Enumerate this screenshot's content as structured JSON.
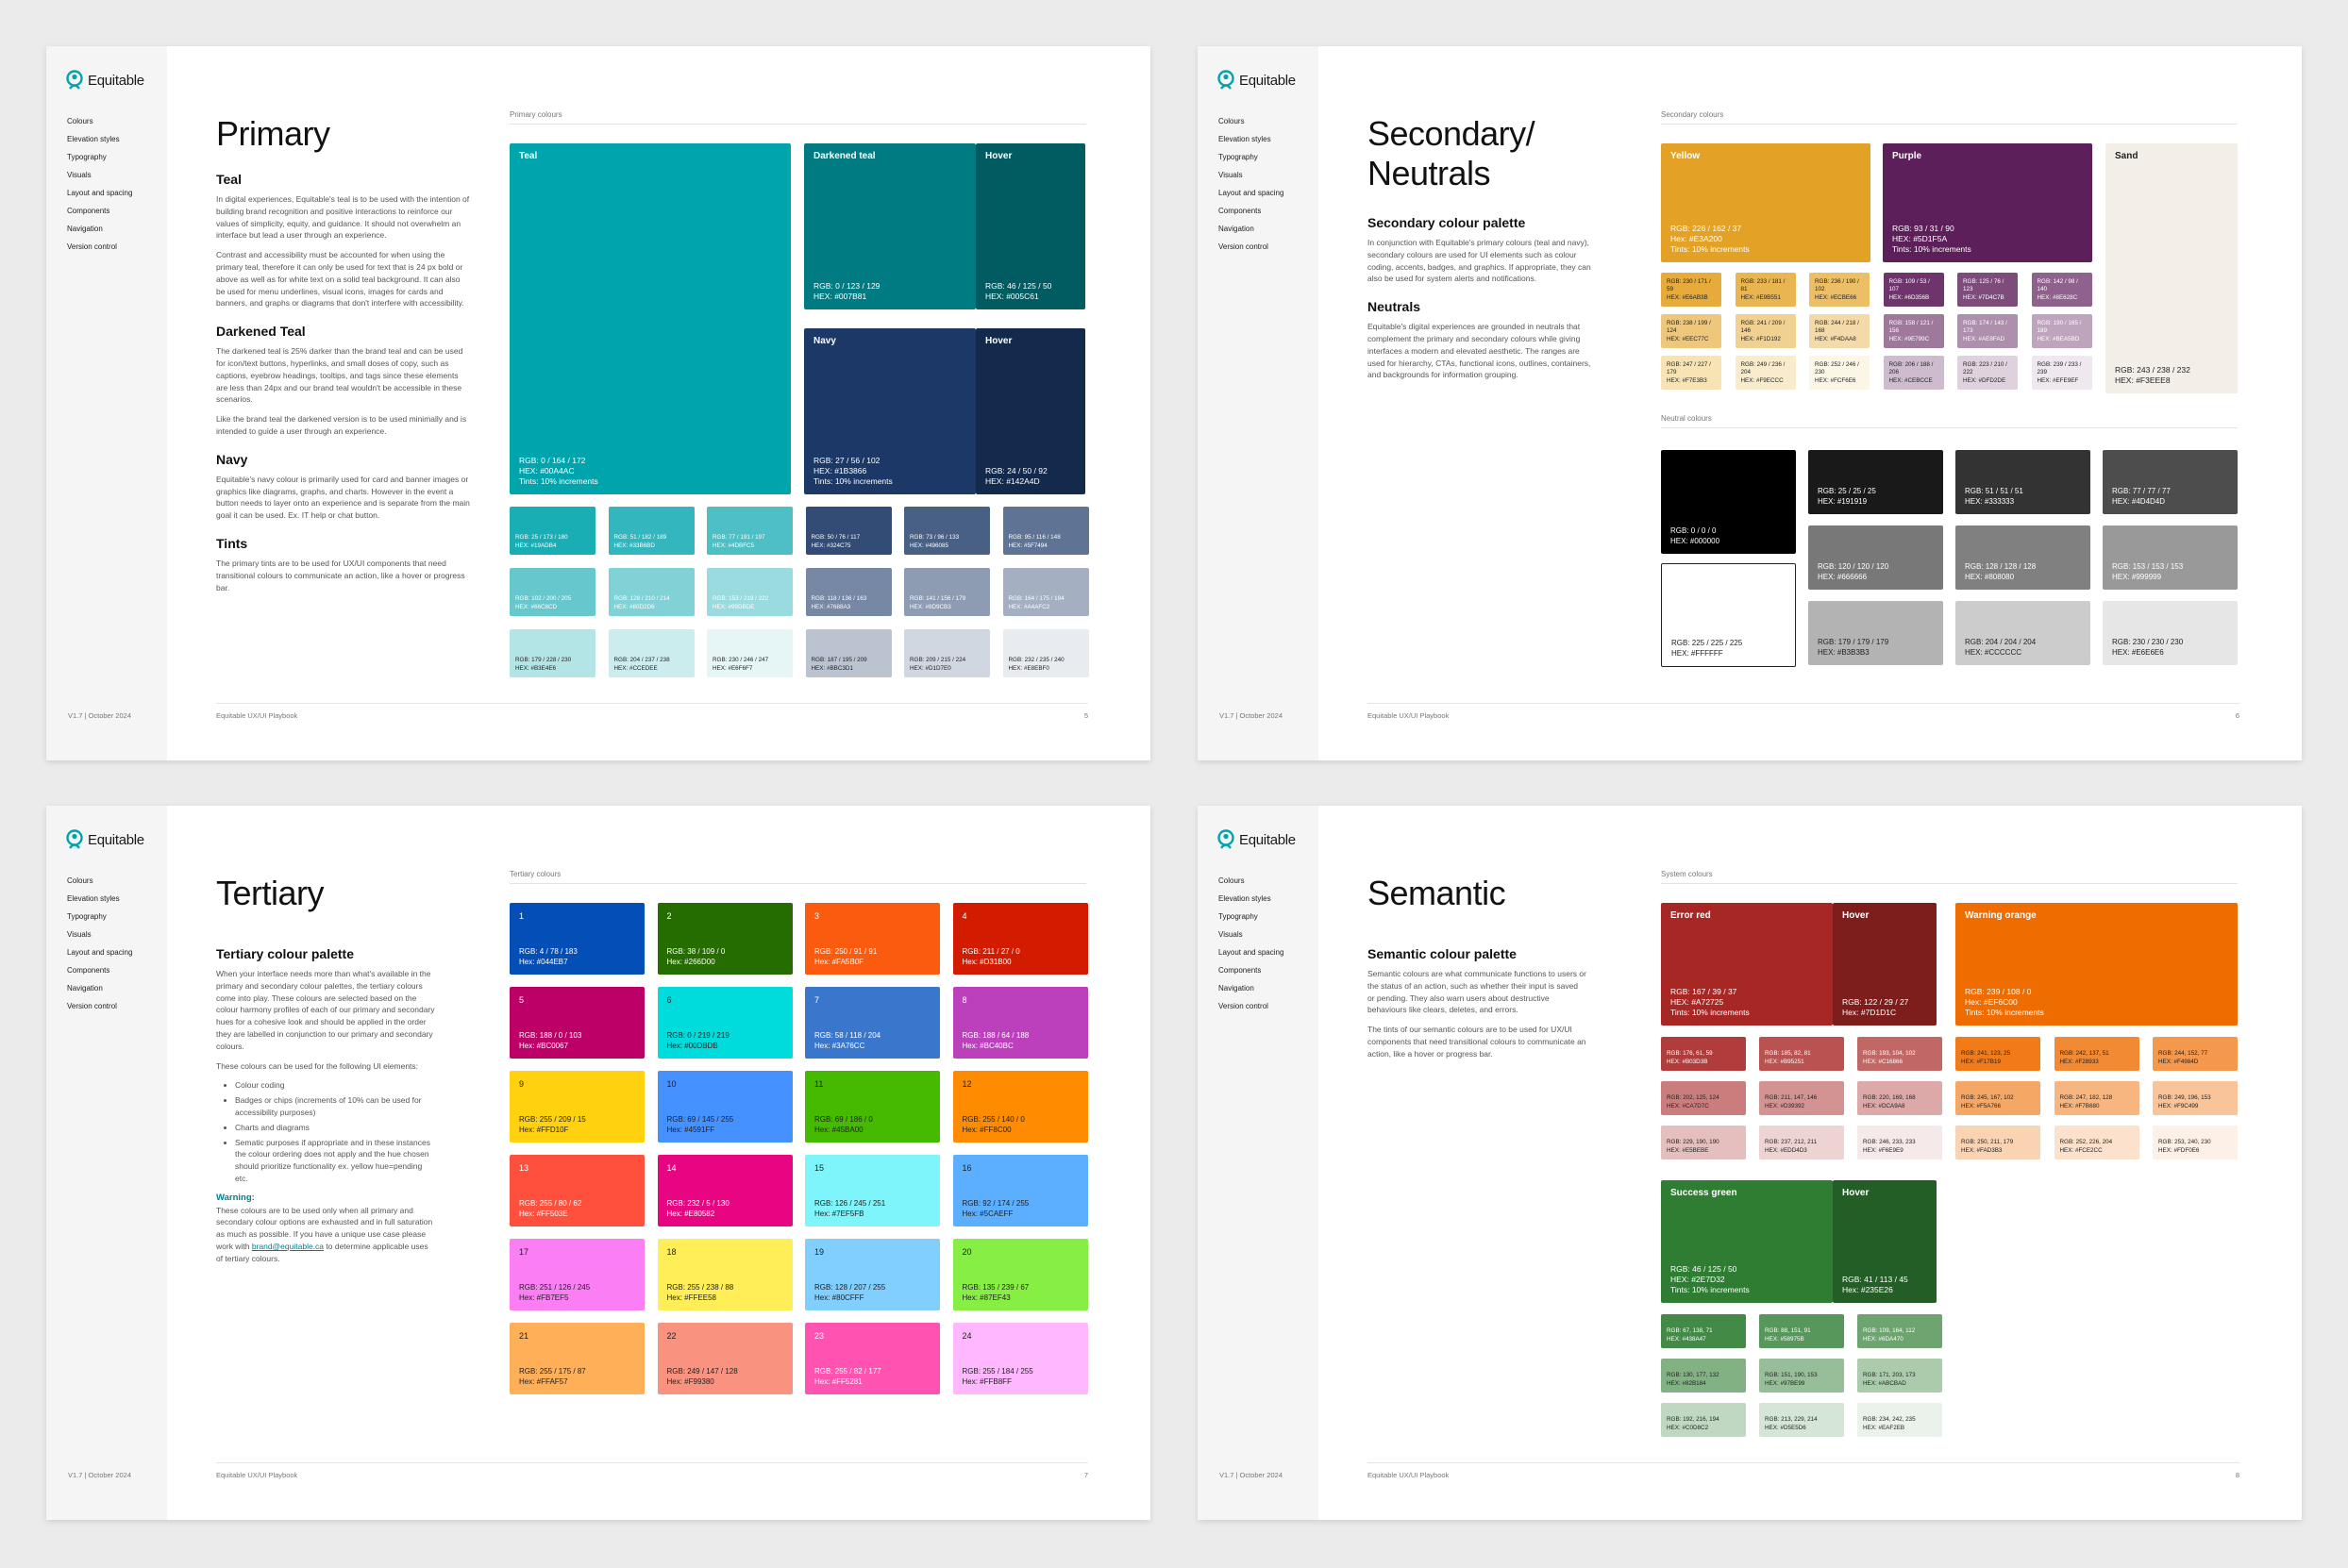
{
  "brand": "Equitable",
  "nav": [
    "Colours",
    "Elevation styles",
    "Typography",
    "Visuals",
    "Layout and spacing",
    "Components",
    "Navigation",
    "Version control"
  ],
  "version": "V1.7 | October 2024",
  "footer": "Equitable UX/UI Playbook",
  "p1": {
    "page": "5",
    "title": "Primary",
    "section": "Primary colours",
    "teal_h": "Teal",
    "teal_p1": "In digital experiences, Equitable's teal is to be used with the intention of building brand recognition and positive interactions to reinforce our values of simplicity, equity, and guidance. It should not overwhelm an interface but lead a user through an experience.",
    "teal_p2": "Contrast and accessibility must be accounted for when using the primary teal, therefore it can only be used for text that is 24 px bold or above as well as for white text on a solid teal background. It can also be used for menu underlines, visual icons, images for cards and banners, and graphs or diagrams that don't interfere with accessibility.",
    "dark_h": "Darkened Teal",
    "dark_p1": "The darkened teal is 25% darker than the brand teal and can be used for icon/text buttons, hyperlinks, and small doses of copy, such as captions, eyebrow headings, tooltips, and tags since these elements are less than 24px and our brand teal wouldn't be accessible in these scenarios.",
    "dark_p2": "Like the brand teal the darkened version is to be used minimally and is intended to guide a user through an experience.",
    "navy_h": "Navy",
    "navy_p": "Equitable's navy colour is primarily used for card and banner images or graphics like diagrams, graphs, and charts. However in the event a button needs to layer onto an experience and is separate from the main goal it can be used. Ex. IT help or chat button.",
    "tints_h": "Tints",
    "tints_p": "The primary tints are to be used for UX/UI components that need transitional colours to communicate an action, like a hover or progress bar.",
    "teal": {
      "name": "Teal",
      "rgb": "RGB: 0 / 164 / 172",
      "hex": "HEX: #00A4AC",
      "tints": "Tints: 10% increments",
      "color": "#00a4ac"
    },
    "dteal": {
      "name": "Darkened teal",
      "rgb": "RGB: 0 / 123 / 129",
      "hex": "HEX: #007B81",
      "color": "#007b81"
    },
    "dteal_hover": {
      "name": "Hover",
      "rgb": "RGB: 46 / 125 / 50",
      "hex": "HEX: #005C61",
      "color": "#005c61"
    },
    "navy": {
      "name": "Navy",
      "rgb": "RGB: 27 / 56 / 102",
      "hex": "HEX: #1B3866",
      "tints": "Tints: 10% increments",
      "color": "#1b3866"
    },
    "navy_hover": {
      "name": "Hover",
      "rgb": "RGB: 24 / 50 / 92",
      "hex": "HEX: #142A4D",
      "color": "#142a4d"
    },
    "tints": [
      {
        "rgb": "RGB: 25 / 173 / 180",
        "hex": "HEX: #19ADB4",
        "color": "#19adb4"
      },
      {
        "rgb": "RGB: 51 / 182 / 189",
        "hex": "HEX: #33B6BD",
        "color": "#33b6bd"
      },
      {
        "rgb": "RGB: 77 / 191 / 197",
        "hex": "HEX: #4DBFC5",
        "color": "#4dbfc5"
      },
      {
        "rgb": "RGB: 50 / 76 / 117",
        "hex": "HEX: #324C75",
        "color": "#324c75"
      },
      {
        "rgb": "RGB: 73 / 96 / 133",
        "hex": "HEX: #496085",
        "color": "#496085"
      },
      {
        "rgb": "RGB: 95 / 116 / 148",
        "hex": "HEX: #5F7494",
        "color": "#5f7494"
      },
      {
        "rgb": "RGB: 102 / 200 / 205",
        "hex": "HEX: #66C8CD",
        "color": "#66c8cd"
      },
      {
        "rgb": "RGB: 128 / 210 / 214",
        "hex": "HEX: #80D2D6",
        "color": "#80d2d6"
      },
      {
        "rgb": "RGB: 153 / 219 / 222",
        "hex": "HEX: #99DBDE",
        "color": "#99dbde"
      },
      {
        "rgb": "RGB: 118 / 136 / 163",
        "hex": "HEX: #7688A3",
        "color": "#7688a3"
      },
      {
        "rgb": "RGB: 141 / 156 / 179",
        "hex": "HEX: #8D9CB3",
        "color": "#8d9cb3"
      },
      {
        "rgb": "RGB: 164 / 175 / 194",
        "hex": "HEX: #A4AFC2",
        "color": "#a4afc2"
      },
      {
        "rgb": "RGB: 179 / 228 / 230",
        "hex": "HEX: #B3E4E6",
        "color": "#b3e4e6"
      },
      {
        "rgb": "RGB: 204 / 237 / 238",
        "hex": "HEX: #CCEDEE",
        "color": "#ccedee"
      },
      {
        "rgb": "RGB: 230 / 246 / 247",
        "hex": "HEX: #E6F6F7",
        "color": "#e6f6f7"
      },
      {
        "rgb": "RGB: 187 / 195 / 209",
        "hex": "HEX: #BBC3D1",
        "color": "#bbc3d1"
      },
      {
        "rgb": "RGB: 209 / 215 / 224",
        "hex": "HEX: #D1D7E0",
        "color": "#d1d7e0"
      },
      {
        "rgb": "RGB: 232 / 235 / 240",
        "hex": "HEX: #E8EBF0",
        "color": "#e8ebf0"
      }
    ]
  },
  "p2": {
    "page": "6",
    "title": "Secondary/ Neutrals",
    "section": "Secondary colours",
    "section2": "Neutral colours",
    "sec_h": "Secondary colour palette",
    "sec_p": "In conjunction with Equitable's primary colours (teal and navy), secondary colours are used for UI elements such as colour coding, accents, badges, and graphics. If appropriate, they can also be used for system alerts and notifications.",
    "neu_h": "Neutrals",
    "neu_p": "Equitable's digital experiences are grounded in neutrals that complement the primary and secondary colours while giving interfaces a modern and elevated aesthetic. The ranges are used for hierarchy, CTAs, functional icons, outlines, containers, and backgrounds for information grouping.",
    "yellow": {
      "name": "Yellow",
      "rgb": "RGB: 226 / 162 / 37",
      "hex": "Hex: #E3A200",
      "tints": "Tints: 10% increments",
      "color": "#e3a225"
    },
    "purple": {
      "name": "Purple",
      "rgb": "RGB: 93 / 31 / 90",
      "hex": "HEX: #5D1F5A",
      "tints": "Tints: 10% increments",
      "color": "#5d1f5a"
    },
    "sand": {
      "name": "Sand",
      "rgb": "RGB: 243 / 238 / 232",
      "hex": "HEX: #F3EEE8",
      "color": "#f3eee8"
    },
    "tints": [
      {
        "rgb": "RGB: 230 / 171 / 59",
        "hex": "HEX: #E6AB3B",
        "color": "#e6ab3b"
      },
      {
        "rgb": "RGB: 233 / 181 / 81",
        "hex": "HEX: #E9B551",
        "color": "#e9b551"
      },
      {
        "rgb": "RGB: 236 / 190 / 102",
        "hex": "HEX: #ECBE66",
        "color": "#ecbe66"
      },
      {
        "rgb": "RGB: 109 / 53 / 107",
        "hex": "HEX: #6D356B",
        "color": "#6d356b"
      },
      {
        "rgb": "RGB: 125 / 76 / 123",
        "hex": "HEX: #7D4C7B",
        "color": "#7d4c7b"
      },
      {
        "rgb": "RGB: 142 / 98 / 140",
        "hex": "HEX: #8E628C",
        "color": "#8e628c"
      },
      {
        "rgb": "RGB: 238 / 199 / 124",
        "hex": "HEX: #EEC77C",
        "color": "#eec77c"
      },
      {
        "rgb": "RGB: 241 / 209 / 146",
        "hex": "HEX: #F1D192",
        "color": "#f1d192"
      },
      {
        "rgb": "RGB: 244 / 218 / 168",
        "hex": "HEX: #F4DAA8",
        "color": "#f4daa8"
      },
      {
        "rgb": "RGB: 158 / 121 / 156",
        "hex": "HEX: #9E799C",
        "color": "#9e799c"
      },
      {
        "rgb": "RGB: 174 / 143 / 173",
        "hex": "HEX: #AE8FAD",
        "color": "#ae8fad"
      },
      {
        "rgb": "RGB: 190 / 165 / 189",
        "hex": "HEX: #BEA5BD",
        "color": "#bea5bd"
      },
      {
        "rgb": "RGB: 247 / 227 / 179",
        "hex": "HEX: #F7E3B3",
        "color": "#f7e3b3"
      },
      {
        "rgb": "RGB: 249 / 236 / 204",
        "hex": "HEX: #F9ECCC",
        "color": "#f9eccc"
      },
      {
        "rgb": "RGB: 252 / 246 / 230",
        "hex": "HEX: #FCF6E6",
        "color": "#fcf6e6"
      },
      {
        "rgb": "RGB: 206 / 188 / 206",
        "hex": "HEX: #CEBCCE",
        "color": "#cebcce"
      },
      {
        "rgb": "RGB: 223 / 210 / 222",
        "hex": "HEX: #DFD2DE",
        "color": "#dfd2de"
      },
      {
        "rgb": "RGB: 239 / 233 / 239",
        "hex": "HEX: #EFE9EF",
        "color": "#efe9ef"
      }
    ],
    "neutrals": [
      {
        "rgb": "RGB: 0 / 0 / 0",
        "hex": "HEX: #000000",
        "color": "#000000",
        "dark": true
      },
      {
        "rgb": "RGB: 25 / 25 / 25",
        "hex": "HEX: #191919",
        "color": "#191919",
        "dark": true
      },
      {
        "rgb": "RGB: 51 / 51 / 51",
        "hex": "HEX: #333333",
        "color": "#333333",
        "dark": true
      },
      {
        "rgb": "RGB: 77 / 77 / 77",
        "hex": "HEX: #4D4D4D",
        "color": "#4d4d4d",
        "dark": true
      },
      {
        "rgb": "RGB: 225 / 225 / 225",
        "hex": "HEX: #FFFFFF",
        "color": "#ffffff",
        "dark": false
      },
      {
        "rgb": "RGB: 120 / 120 / 120",
        "hex": "HEX: #666666",
        "color": "#787878",
        "dark": true
      },
      {
        "rgb": "RGB: 128 / 128 / 128",
        "hex": "HEX: #808080",
        "color": "#808080",
        "dark": true
      },
      {
        "rgb": "RGB: 153 / 153 / 153",
        "hex": "HEX: #999999",
        "color": "#999999",
        "dark": true
      },
      {
        "rgb": "RGB: 179 / 179 / 179",
        "hex": "HEX: #B3B3B3",
        "color": "#b3b3b3",
        "dark": false
      },
      {
        "rgb": "RGB: 204 / 204 / 204",
        "hex": "HEX: #CCCCCC",
        "color": "#cccccc",
        "dark": false
      },
      {
        "rgb": "RGB: 230 / 230 / 230",
        "hex": "HEX: #E6E6E6",
        "color": "#e6e6e6",
        "dark": false
      }
    ]
  },
  "p3": {
    "page": "7",
    "title": "Tertiary",
    "section": "Tertiary colours",
    "h": "Tertiary colour palette",
    "p1": "When your interface needs more than what's available in the primary and secondary colour palettes, the tertiary colours come into play. These colours are selected based on the colour harmony profiles of each of our primary and secondary hues for a cohesive look and should be applied in the order they are labelled in conjunction to our primary and secondary colours.",
    "p2": "These colours can be used for the following UI elements:",
    "bullets": [
      "Colour coding",
      "Badges or chips (increments of 10% can be used for accessibility purposes)",
      "Charts and diagrams",
      "Sematic purposes if appropriate and in these instances the colour ordering does not apply and the hue chosen should prioritize functionality ex. yellow hue=pending etc."
    ],
    "warn": "Warning:",
    "warn_p": "These colours are to be used only when all primary and secondary colour options are exhausted and in full saturation as much as possible. If you have a unique use case please work with",
    "email": "brand@equitable.ca",
    "warn_p2": "to determine applicable uses of tertiary colours.",
    "swatches": [
      {
        "num": "1",
        "rgb": "RGB: 4 / 78 / 183",
        "hex": "Hex: #044EB7",
        "color": "#044eb7",
        "dark": true
      },
      {
        "num": "2",
        "rgb": "RGB: 38 / 109 / 0",
        "hex": "Hex: #266D00",
        "color": "#266d00",
        "dark": true
      },
      {
        "num": "3",
        "rgb": "RGB: 250 / 91 / 91",
        "hex": "Hex: #FA5B0F",
        "color": "#fa5b0f",
        "dark": true
      },
      {
        "num": "4",
        "rgb": "RGB: 211 / 27 / 0",
        "hex": "Hex: #D31B00",
        "color": "#d31b00",
        "dark": true
      },
      {
        "num": "5",
        "rgb": "RGB: 188 / 0 / 103",
        "hex": "Hex: #BC0067",
        "color": "#bc0067",
        "dark": true
      },
      {
        "num": "6",
        "rgb": "RGB: 0 / 219 / 219",
        "hex": "Hex: #00DBDB",
        "color": "#00dbdb",
        "dark": false
      },
      {
        "num": "7",
        "rgb": "RGB: 58 / 118 / 204",
        "hex": "Hex: #3A76CC",
        "color": "#3a76cc",
        "dark": true
      },
      {
        "num": "8",
        "rgb": "RGB: 188 / 64 / 188",
        "hex": "Hex: #BC40BC",
        "color": "#bc40bc",
        "dark": true
      },
      {
        "num": "9",
        "rgb": "RGB: 255 / 209 / 15",
        "hex": "Hex: #FFD10F",
        "color": "#ffd10f",
        "dark": false
      },
      {
        "num": "10",
        "rgb": "RGB: 69 / 145 / 255",
        "hex": "Hex: #4591FF",
        "color": "#4591ff",
        "dark": false
      },
      {
        "num": "11",
        "rgb": "RGB: 69 / 186 / 0",
        "hex": "Hex: #45BA00",
        "color": "#45ba00",
        "dark": false
      },
      {
        "num": "12",
        "rgb": "RGB: 255 / 140 / 0",
        "hex": "Hex: #FF8C00",
        "color": "#ff8c00",
        "dark": false
      },
      {
        "num": "13",
        "rgb": "RGB: 255 / 80 / 62",
        "hex": "Hex: #FF503E",
        "color": "#ff503e",
        "dark": true
      },
      {
        "num": "14",
        "rgb": "RGB: 232 / 5 / 130",
        "hex": "Hex: #E80582",
        "color": "#e80582",
        "dark": true
      },
      {
        "num": "15",
        "rgb": "RGB: 126 / 245 / 251",
        "hex": "Hex: #7EF5FB",
        "color": "#7ef5fb",
        "dark": false
      },
      {
        "num": "16",
        "rgb": "RGB: 92 / 174 / 255",
        "hex": "Hex: #5CAEFF",
        "color": "#5caeff",
        "dark": false
      },
      {
        "num": "17",
        "rgb": "RGB: 251 / 126 / 245",
        "hex": "Hex: #FB7EF5",
        "color": "#fb7ef5",
        "dark": false
      },
      {
        "num": "18",
        "rgb": "RGB: 255 / 238 / 88",
        "hex": "Hex: #FFEE58",
        "color": "#ffee58",
        "dark": false
      },
      {
        "num": "19",
        "rgb": "RGB: 128 / 207 / 255",
        "hex": "Hex: #80CFFF",
        "color": "#80cfff",
        "dark": false
      },
      {
        "num": "20",
        "rgb": "RGB: 135 / 239 / 67",
        "hex": "Hex: #87EF43",
        "color": "#87ef43",
        "dark": false
      },
      {
        "num": "21",
        "rgb": "RGB: 255 / 175 / 87",
        "hex": "Hex: #FFAF57",
        "color": "#ffaf57",
        "dark": false
      },
      {
        "num": "22",
        "rgb": "RGB: 249 / 147 / 128",
        "hex": "Hex: #F99380",
        "color": "#f99380",
        "dark": false
      },
      {
        "num": "23",
        "rgb": "RGB: 255 / 82 / 177",
        "hex": "Hex: #FF5281",
        "color": "#ff52b1",
        "dark": true
      },
      {
        "num": "24",
        "rgb": "RGB: 255 / 184 / 255",
        "hex": "Hex: #FFB8FF",
        "color": "#ffb8ff",
        "dark": false
      }
    ]
  },
  "p4": {
    "page": "8",
    "title": "Semantic",
    "section": "System colours",
    "h": "Semantic colour palette",
    "p1": "Semantic colours are what communicate functions to users or the status of an action, such as whether their input is saved or pending. They also warn users about destructive behaviours like clears, deletes, and errors.",
    "p2": "The tints of our semantic colours are to be used for UX/UI components that need transitional colours to communicate an action, like a hover or progress bar.",
    "error": {
      "name": "Error red",
      "rgb": "RGB: 167 / 39 / 37",
      "hex": "HEX: #A72725",
      "tints": "Tints: 10% increments",
      "color": "#a72725"
    },
    "error_hover": {
      "name": "Hover",
      "rgb": "RGB: 122 / 29 / 27",
      "hex": "Hex: #7D1D1C",
      "color": "#7d1d1c"
    },
    "warn": {
      "name": "Warning orange",
      "rgb": "RGB: 239 / 108 / 0",
      "hex": "Hex: #EF6C00",
      "tints": "Tints: 10% increments",
      "color": "#ef6c00"
    },
    "success": {
      "name": "Success green",
      "rgb": "RGB: 46 / 125 / 50",
      "hex": "HEX: #2E7D32",
      "tints": "Tints: 10% increments",
      "color": "#2e7d32"
    },
    "success_hover": {
      "name": "Hover",
      "rgb": "RGB: 41 / 113 / 45",
      "hex": "Hex: #235E26",
      "color": "#235e26"
    },
    "red_tints": [
      {
        "rgb": "RGB: 176, 61, 59",
        "hex": "HEX: #B03D3B",
        "color": "#b03d3b",
        "dark": true
      },
      {
        "rgb": "RGB: 185, 82, 81",
        "hex": "HEX: #B95251",
        "color": "#b95251",
        "dark": true
      },
      {
        "rgb": "RGB: 193, 104, 102",
        "hex": "HEX: #C16866",
        "color": "#c16866",
        "dark": true
      },
      {
        "rgb": "RGB: 202, 125, 124",
        "hex": "HEX: #CA7D7C",
        "color": "#ca7d7c",
        "dark": false
      },
      {
        "rgb": "RGB: 211, 147, 146",
        "hex": "HEX: #D39392",
        "color": "#d39392",
        "dark": false
      },
      {
        "rgb": "RGB: 220, 169, 168",
        "hex": "HEX: #DCA9A8",
        "color": "#dca9a8",
        "dark": false
      },
      {
        "rgb": "RGB: 229, 190, 190",
        "hex": "HEX: #E5BEBE",
        "color": "#e5bebe",
        "dark": false
      },
      {
        "rgb": "RGB: 237, 212, 211",
        "hex": "HEX: #EDD4D3",
        "color": "#edd4d3",
        "dark": false
      },
      {
        "rgb": "RGB: 246, 233, 233",
        "hex": "HEX: #F6E9E9",
        "color": "#f6e9e9",
        "dark": false
      }
    ],
    "orange_tints": [
      {
        "rgb": "RGB: 241, 123, 25",
        "hex": "HEX: #F17B19",
        "color": "#f17b19",
        "dark": false
      },
      {
        "rgb": "RGB: 242, 137, 51",
        "hex": "HEX: #F28933",
        "color": "#f28933",
        "dark": false
      },
      {
        "rgb": "RGB: 244, 152, 77",
        "hex": "HEX: #F4984D",
        "color": "#f4984d",
        "dark": false
      },
      {
        "rgb": "RGB: 245, 167, 102",
        "hex": "HEX: #F5A766",
        "color": "#f5a766",
        "dark": false
      },
      {
        "rgb": "RGB: 247, 182, 128",
        "hex": "HEX: #F7B680",
        "color": "#f7b680",
        "dark": false
      },
      {
        "rgb": "RGB: 249, 196, 153",
        "hex": "HEX: #F9C499",
        "color": "#f9c499",
        "dark": false
      },
      {
        "rgb": "RGB: 250, 211, 179",
        "hex": "HEX: #FAD3B3",
        "color": "#fad3b3",
        "dark": false
      },
      {
        "rgb": "RGB: 252, 226, 204",
        "hex": "HEX: #FCE2CC",
        "color": "#fce2cc",
        "dark": false
      },
      {
        "rgb": "RGB: 253, 240, 230",
        "hex": "HEX: #FDF0E6",
        "color": "#fdf0e6",
        "dark": false
      }
    ],
    "green_tints": [
      {
        "rgb": "RGB: 67, 138, 71",
        "hex": "HEX: #438A47",
        "color": "#438a47",
        "dark": true
      },
      {
        "rgb": "RGB: 88, 151, 91",
        "hex": "HEX: #58975B",
        "color": "#58975b",
        "dark": true
      },
      {
        "rgb": "RGB: 109, 164, 112",
        "hex": "HEX: #6DA470",
        "color": "#6da470",
        "dark": true
      },
      {
        "rgb": "RGB: 130, 177, 132",
        "hex": "HEX: #82B184",
        "color": "#82b184",
        "dark": false
      },
      {
        "rgb": "RGB: 151, 190, 153",
        "hex": "HEX: #97BE99",
        "color": "#97be99",
        "dark": false
      },
      {
        "rgb": "RGB: 171, 203, 173",
        "hex": "HEX: #ABCBAD",
        "color": "#abcbad",
        "dark": false
      },
      {
        "rgb": "RGB: 192, 216, 194",
        "hex": "HEX: #C0D8C2",
        "color": "#c0d8c2",
        "dark": false
      },
      {
        "rgb": "RGB: 213, 229, 214",
        "hex": "HEX: #D5E5D6",
        "color": "#d5e5d6",
        "dark": false
      },
      {
        "rgb": "RGB: 234, 242, 235",
        "hex": "HEX: #EAF2EB",
        "color": "#eaf2eb",
        "dark": false
      }
    ]
  }
}
